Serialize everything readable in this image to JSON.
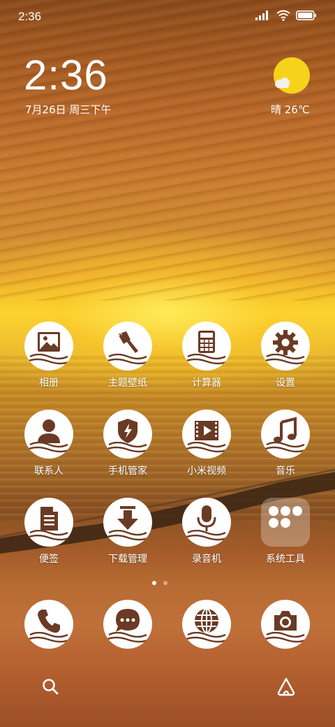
{
  "status_bar": {
    "time": "2:36",
    "icons": [
      "signal-icon",
      "wifi-icon",
      "battery-icon"
    ]
  },
  "clock_widget": {
    "time": "2:36",
    "date": "7月26日 周三下午"
  },
  "weather_widget": {
    "icon": "sunny-cloud-icon",
    "text": "晴 26℃"
  },
  "apps": [
    {
      "label": "相册",
      "icon": "gallery-icon"
    },
    {
      "label": "主题壁纸",
      "icon": "theme-brush-icon"
    },
    {
      "label": "计算器",
      "icon": "calculator-icon"
    },
    {
      "label": "设置",
      "icon": "gear-icon"
    },
    {
      "label": "联系人",
      "icon": "contact-icon"
    },
    {
      "label": "手机管家",
      "icon": "security-shield-icon"
    },
    {
      "label": "小米视频",
      "icon": "video-icon"
    },
    {
      "label": "音乐",
      "icon": "music-note-icon"
    },
    {
      "label": "便签",
      "icon": "notes-icon"
    },
    {
      "label": "下载管理",
      "icon": "download-icon"
    },
    {
      "label": "录音机",
      "icon": "microphone-icon"
    },
    {
      "label": "系统工具",
      "icon": "folder-icon"
    }
  ],
  "page_indicator": {
    "pages": 2,
    "active": 1
  },
  "dock": [
    {
      "icon": "phone-icon"
    },
    {
      "icon": "message-icon"
    },
    {
      "icon": "browser-globe-icon"
    },
    {
      "icon": "camera-icon"
    }
  ],
  "bottom_bar": {
    "left": "search-icon",
    "right": "app-vault-icon"
  },
  "colors": {
    "icon_brown": "#6b3a24",
    "icon_bg": "#ffffff",
    "sun": "#f7d21a"
  }
}
